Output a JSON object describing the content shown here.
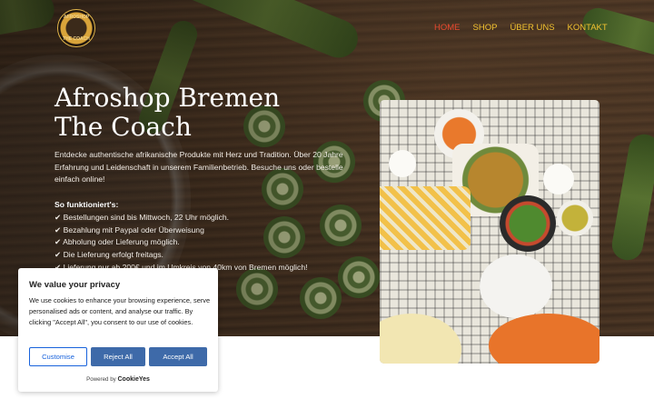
{
  "brand": {
    "logo_top": "AFROSHOP",
    "logo_bottom": "THE COACH"
  },
  "nav": {
    "items": [
      {
        "label": "HOME",
        "active": true
      },
      {
        "label": "SHOP",
        "active": false
      },
      {
        "label": "ÜBER UNS",
        "active": false
      },
      {
        "label": "KONTAKT",
        "active": false
      }
    ]
  },
  "hero": {
    "title_line1": "Afroshop Bremen",
    "title_line2": "The Coach",
    "description": "Entdecke authentische afrikanische Produkte mit Herz und Tradition. Über 20 Jahre Erfahrung und Leidenschaft in unserem Familienbetrieb. Besuche uns oder bestelle einfach online!",
    "how_title": "So funktioniert's:",
    "steps": [
      "✔ Bestellungen sind bis Mittwoch, 22 Uhr möglich.",
      "✔ Bezahlung mit Paypal oder Überweisung",
      "✔ Abholung oder Lieferung möglich.",
      "✔ Die Lieferung erfolgt freitags.",
      "✔ Lieferung nur ab 200€ und im Umkreis von 40km von Bremen möglich!"
    ]
  },
  "cookie": {
    "title": "We value your privacy",
    "text": "We use cookies to enhance your browsing experience, serve personalised ads or content, and analyse our traffic. By clicking \"Accept All\", you consent to our use of cookies.",
    "customise_label": "Customise",
    "reject_label": "Reject All",
    "accept_label": "Accept All",
    "powered_by": "Powered by",
    "powered_brand": "CookieYes"
  },
  "colors": {
    "nav_link": "#f2c230",
    "nav_active": "#e8492f",
    "cookie_button": "#3e6aa9",
    "cookie_outline": "#1863dc"
  }
}
